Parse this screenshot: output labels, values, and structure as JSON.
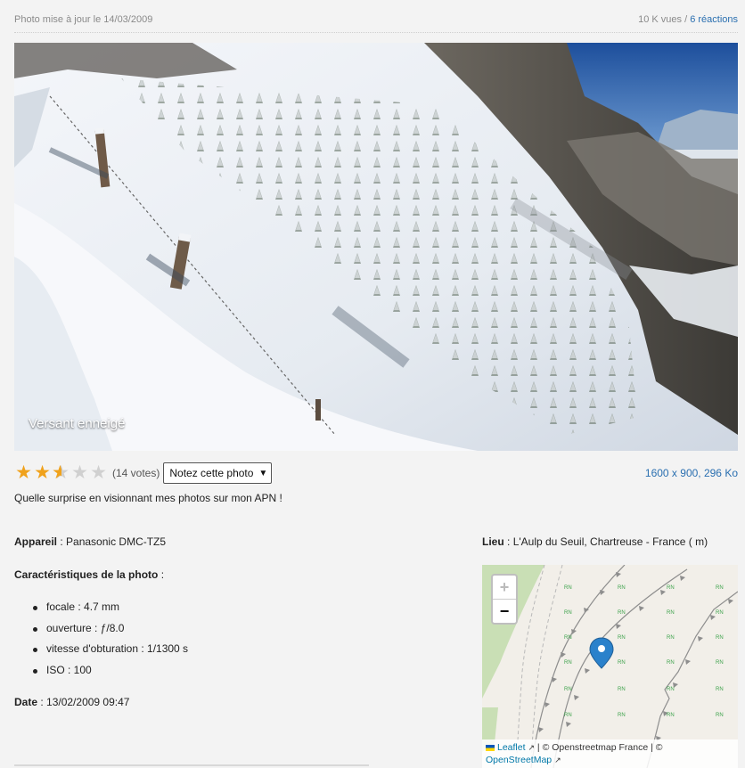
{
  "header": {
    "updated": "Photo mise à jour le 14/03/2009",
    "views": "10 K vues",
    "separator": "/",
    "reactions": "6 réactions"
  },
  "photo": {
    "caption": "Versant enneigé"
  },
  "rating": {
    "stars": 2.5,
    "max": 5,
    "votes": "(14 votes)",
    "select_label": "Notez cette photo",
    "dimensions": "1600 x 900, 296 Ko"
  },
  "description": "Quelle surprise en visionnant mes photos sur mon APN !",
  "camera": {
    "label": "Appareil",
    "value": "Panasonic DMC-TZ5"
  },
  "characteristics": {
    "label": "Caractéristiques de la photo",
    "items": [
      "focale : 4.7 mm",
      "ouverture : ƒ/8.0",
      "vitesse d'obturation : 1/1300 s",
      "ISO : 100"
    ]
  },
  "date": {
    "label": "Date",
    "value": "13/02/2009 09:47"
  },
  "location": {
    "label": "Lieu",
    "value": "L'Aulp du Seuil, Chartreuse - France ( m)"
  },
  "map": {
    "zoom_in": "+",
    "zoom_out": "−",
    "marker_label": "RN",
    "attribution_leaflet": "Leaflet",
    "attribution_mid": "| © Openstreetmap France | ©",
    "attribution_osm": "OpenStreetMap",
    "marker_color": "#2a81cb"
  },
  "colors": {
    "link": "#2a6fb0",
    "star": "#f0a21c"
  }
}
